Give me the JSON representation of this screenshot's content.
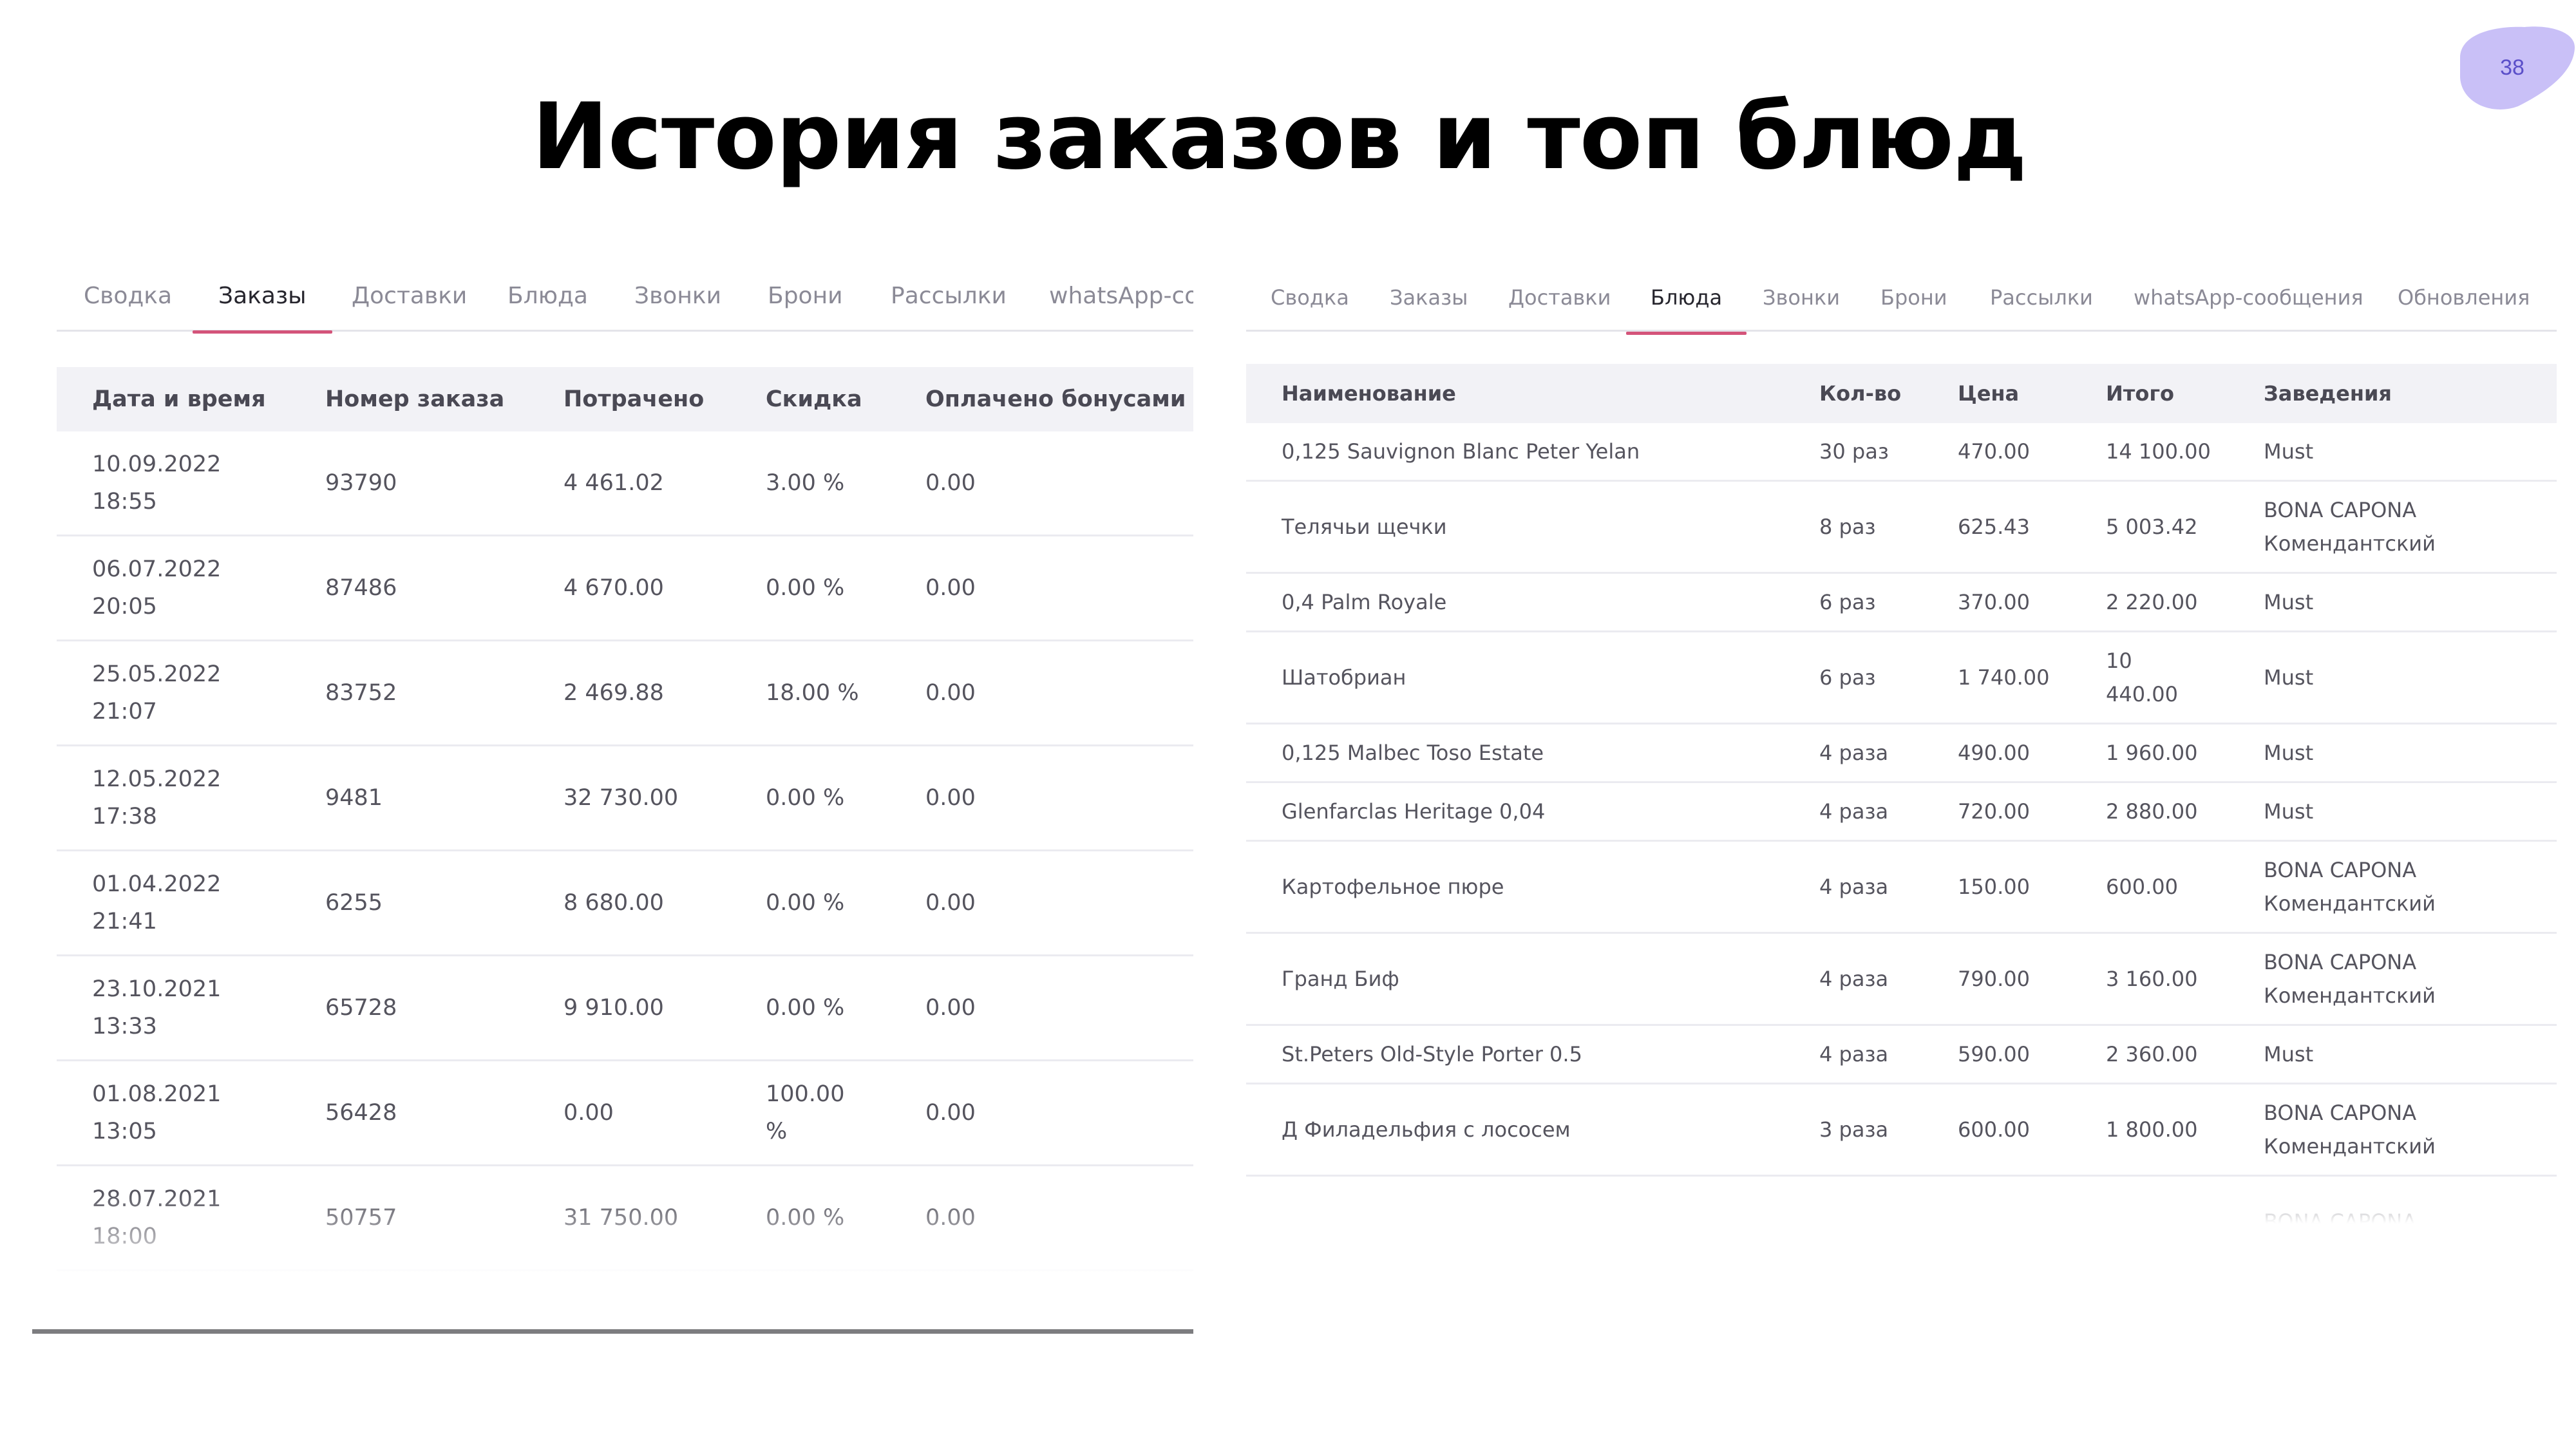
{
  "slide": {
    "title": "История заказов и топ блюд",
    "page_number": "38",
    "accent_blob_color": "#c9c0f7",
    "accent_color": "#d4547a"
  },
  "orders_panel": {
    "tabs": [
      "Сводка",
      "Заказы",
      "Доставки",
      "Блюда",
      "Звонки",
      "Брони",
      "Рассылки",
      "whatsApp-co"
    ],
    "active_tab": "Заказы",
    "columns": [
      "Дата и время",
      "Номер заказа",
      "Потрачено",
      "Скидка",
      "Оплачено бонусами"
    ],
    "rows": [
      {
        "date": "10.09.2022",
        "time": "18:55",
        "number": "93790",
        "spent": "4 461.02",
        "discount": "3.00 %",
        "discount2": "",
        "bonus": "0.00"
      },
      {
        "date": "06.07.2022",
        "time": "20:05",
        "number": "87486",
        "spent": "4 670.00",
        "discount": "0.00 %",
        "discount2": "",
        "bonus": "0.00"
      },
      {
        "date": "25.05.2022",
        "time": "21:07",
        "number": "83752",
        "spent": "2 469.88",
        "discount": "18.00 %",
        "discount2": "",
        "bonus": "0.00"
      },
      {
        "date": "12.05.2022",
        "time": "17:38",
        "number": "9481",
        "spent": "32 730.00",
        "discount": "0.00 %",
        "discount2": "",
        "bonus": "0.00"
      },
      {
        "date": "01.04.2022",
        "time": "21:41",
        "number": "6255",
        "spent": "8 680.00",
        "discount": "0.00 %",
        "discount2": "",
        "bonus": "0.00"
      },
      {
        "date": "23.10.2021",
        "time": "13:33",
        "number": "65728",
        "spent": "9 910.00",
        "discount": "0.00 %",
        "discount2": "",
        "bonus": "0.00"
      },
      {
        "date": "01.08.2021",
        "time": "13:05",
        "number": "56428",
        "spent": "0.00",
        "discount": "100.00",
        "discount2": "%",
        "bonus": "0.00"
      },
      {
        "date": "28.07.2021",
        "time": "18:00",
        "number": "50757",
        "spent": "31 750.00",
        "discount": "0.00 %",
        "discount2": "",
        "bonus": "0.00"
      }
    ]
  },
  "dishes_panel": {
    "tabs": [
      "Сводка",
      "Заказы",
      "Доставки",
      "Блюда",
      "Звонки",
      "Брони",
      "Рассылки",
      "whatsApp-сообщения",
      "Обновления"
    ],
    "active_tab": "Блюда",
    "columns": [
      "Наименование",
      "Кол-во",
      "Цена",
      "Итого",
      "Заведения"
    ],
    "rows": [
      {
        "name": "0,125 Sauvignon Blanc Peter Yelan",
        "qty": "30 раз",
        "price": "470.00",
        "total": "14 100.00",
        "total2": "",
        "place": "Must",
        "place2": ""
      },
      {
        "name": "Телячьи щечки",
        "qty": "8 раз",
        "price": "625.43",
        "total": "5 003.42",
        "total2": "",
        "place": "BONA CAPONA",
        "place2": "Комендантский"
      },
      {
        "name": "0,4 Palm Royale",
        "qty": "6 раз",
        "price": "370.00",
        "total": "2 220.00",
        "total2": "",
        "place": "Must",
        "place2": ""
      },
      {
        "name": "Шатобриан",
        "qty": "6 раз",
        "price": "1 740.00",
        "total": "10",
        "total2": "440.00",
        "place": "Must",
        "place2": ""
      },
      {
        "name": "0,125 Malbec Toso Estate",
        "qty": "4 раза",
        "price": "490.00",
        "total": "1 960.00",
        "total2": "",
        "place": "Must",
        "place2": ""
      },
      {
        "name": "Glenfarclas Heritage 0,04",
        "qty": "4 раза",
        "price": "720.00",
        "total": "2 880.00",
        "total2": "",
        "place": "Must",
        "place2": ""
      },
      {
        "name": "Картофельное пюре",
        "qty": "4 раза",
        "price": "150.00",
        "total": "600.00",
        "total2": "",
        "place": "BONA CAPONA",
        "place2": "Комендантский"
      },
      {
        "name": "Гранд Биф",
        "qty": "4 раза",
        "price": "790.00",
        "total": "3 160.00",
        "total2": "",
        "place": "BONA CAPONA",
        "place2": "Комендантский"
      },
      {
        "name": "St.Peters Old-Style Porter 0.5",
        "qty": "4 раза",
        "price": "590.00",
        "total": "2 360.00",
        "total2": "",
        "place": "Must",
        "place2": ""
      },
      {
        "name": "Д Филадельфия с лососем",
        "qty": "3 раза",
        "price": "600.00",
        "total": "1 800.00",
        "total2": "",
        "place": "BONA CAPONA",
        "place2": "Комендантский"
      },
      {
        "name": "",
        "qty": "",
        "price": "",
        "total": "",
        "total2": "",
        "place": "BONA CAPONA",
        "place2": ""
      }
    ]
  }
}
